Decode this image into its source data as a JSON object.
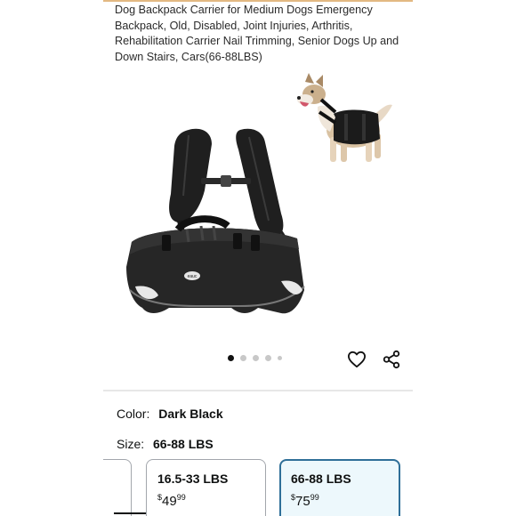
{
  "product": {
    "title": "Dog Backpack Carrier for Medium Dogs Emergency Backpack, Old, Disabled, Joint Injuries, Arthritis, Rehabilitation Carrier Nail Trimming, Senior Dogs Up and Down Stairs, Cars(66-88LBS)"
  },
  "gallery": {
    "image_count": 5,
    "active_index": 0,
    "carrier_logo": "eauc"
  },
  "actions": {
    "favorite_icon": "heart-icon",
    "share_icon": "share-icon"
  },
  "variants": {
    "color_label": "Color:",
    "color_value": "Dark Black",
    "size_label": "Size:",
    "size_value": "66-88 LBS",
    "options": [
      {
        "size": "16.5-33 LBS",
        "currency": "$",
        "whole": "49",
        "cents": "99"
      },
      {
        "size": "66-88 LBS",
        "currency": "$",
        "whole": "75",
        "cents": "99"
      }
    ],
    "selected_index": 1
  },
  "colors": {
    "selected_border": "#2f6f98",
    "selected_bg": "#edf8fc",
    "top_accent": "#e3b982"
  }
}
